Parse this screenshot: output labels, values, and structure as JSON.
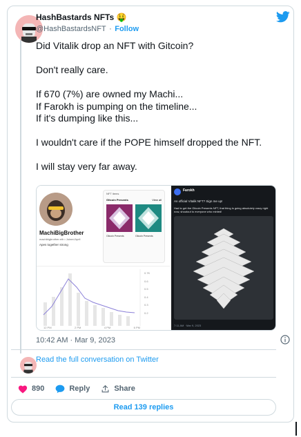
{
  "author": {
    "name": "HashBastards NFTs 🤑",
    "handle": "@HashBastardsNFT",
    "separator": "·",
    "follow_label": "Follow"
  },
  "tweet": {
    "lines": [
      "Did Vitalik drop an NFT with Gitcoin?",
      "Don't really care.",
      "If 670 (7%) are owned my Machi...\nIf Farokh is pumping on the timeline...\nIf it's dumping like this...",
      "I wouldn't care if the POPE himself dropped the NFT.",
      "I will stay very far away."
    ]
  },
  "media": {
    "left_panel": {
      "profile_name": "MachiBigBrother",
      "profile_handle": "machibigbrother.eth • Joined April",
      "profile_bio": "Apes together strong",
      "nft_header": "NFT items",
      "collection_label": "Gitcoin Presents",
      "view_all": "View all",
      "card1_title": "Gitcoin Presents",
      "card2_title": "Gitcoin Presents",
      "chart_y_labels": [
        "0.7K",
        "0.6",
        "0.5",
        "0.4",
        "0.3",
        "0.2"
      ],
      "chart_x_labels": [
        "12 PM",
        "2 PM",
        "4 PM",
        "6 PM"
      ]
    },
    "right_panel": {
      "author": "Farokh",
      "text1": "An official Vitalik NFT? Sign me up!",
      "text2": "Had to get the Gitcoin Presents NFT, that thing is going absolutely crazy right now, shoutout to everyone who minted!",
      "footer": "7:11 AM · Mar 9, 2023"
    }
  },
  "timestamp": "10:42 AM · Mar 9, 2023",
  "read_conversation": "Read the full conversation on Twitter",
  "actions": {
    "likes_count": "890",
    "reply_label": "Reply",
    "share_label": "Share"
  },
  "read_replies": "Read 139 replies",
  "colors": {
    "accent": "#1d9bf0",
    "like": "#f91880",
    "border": "#cfd9de",
    "secondary_text": "#536471"
  }
}
